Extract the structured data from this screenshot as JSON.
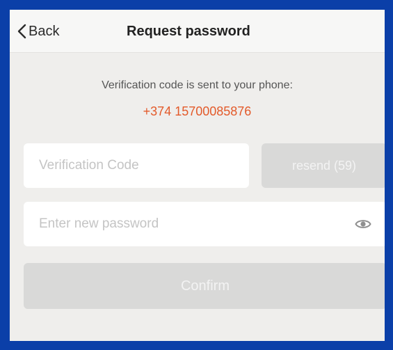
{
  "navbar": {
    "back_label": "Back",
    "title": "Request password"
  },
  "message": {
    "text": "Verification code is sent to your phone:",
    "phone": "+374 15700085876"
  },
  "verification": {
    "placeholder": "Verification Code",
    "resend_label": "resend (59)"
  },
  "password": {
    "placeholder": "Enter new password",
    "toggle_icon": "eye-icon"
  },
  "confirm_label": "Confirm",
  "colors": {
    "frame": "#0b3fa8",
    "background": "#efeeec",
    "phone_accent": "#e35a2a",
    "disabled_button": "#d9d9d8"
  }
}
